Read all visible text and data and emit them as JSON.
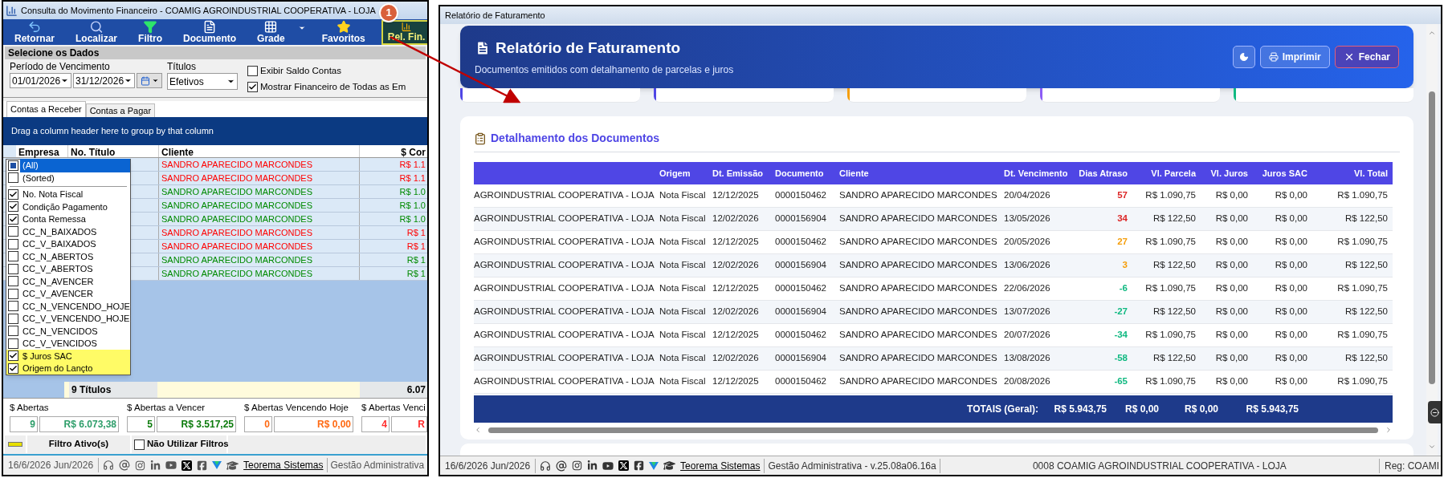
{
  "annotation": {
    "badge": "1"
  },
  "consulta_window": {
    "title": "Consulta do Movimento Financeiro - COAMIG AGROINDUSTRIAL COOPERATIVA - LOJA",
    "toolbar": [
      {
        "label": "Retornar",
        "kind": "return",
        "menu": false,
        "selected": false
      },
      {
        "label": "Localizar",
        "kind": "search",
        "menu": false,
        "selected": false
      },
      {
        "label": "Filtro",
        "kind": "filter",
        "menu": false,
        "selected": false
      },
      {
        "label": "Documento",
        "kind": "document",
        "menu": false,
        "selected": false
      },
      {
        "label": "Grade",
        "kind": "grid",
        "menu": true,
        "selected": false
      },
      {
        "label": "Favoritos",
        "kind": "favorites",
        "menu": false,
        "selected": false
      },
      {
        "label": "Rel. Fin.",
        "kind": "report",
        "menu": false,
        "selected": true
      }
    ],
    "section_title": "Selecione os Dados",
    "period": {
      "label": "Período de Vencimento",
      "from": "01/01/2026",
      "to": "31/12/2026"
    },
    "titulos": {
      "label": "Títulos",
      "value": "Efetivos"
    },
    "options": [
      {
        "label": "Exibir Saldo Contas",
        "checked": false
      },
      {
        "label": "Mostrar Financeiro de Todas as Em",
        "checked": true
      }
    ],
    "tabs": [
      {
        "label": "Contas a Receber",
        "selected": true
      },
      {
        "label": "Contas a Pagar",
        "selected": false
      }
    ],
    "group_hint": "Drag a column header here to group by that column",
    "columns": [
      "Empresa",
      "No. Título",
      "Cliente",
      "$ Cor"
    ],
    "rows": [
      {
        "cliente": "SANDRO APARECIDO MARCONDES",
        "valor": "R$ 1.1",
        "color": "#ff0000"
      },
      {
        "cliente": "SANDRO APARECIDO MARCONDES",
        "valor": "R$ 1.1",
        "color": "#ff0000"
      },
      {
        "cliente": "SANDRO APARECIDO MARCONDES",
        "valor": "R$ 1.0",
        "color": "#008a00"
      },
      {
        "cliente": "SANDRO APARECIDO MARCONDES",
        "valor": "R$ 1.0",
        "color": "#008a00"
      },
      {
        "cliente": "SANDRO APARECIDO MARCONDES",
        "valor": "R$ 1.0",
        "color": "#008a00"
      },
      {
        "cliente": "SANDRO APARECIDO MARCONDES",
        "valor": "R$ 1",
        "color": "#ff0000"
      },
      {
        "cliente": "SANDRO APARECIDO MARCONDES",
        "valor": "R$ 1",
        "color": "#ff0000"
      },
      {
        "cliente": "SANDRO APARECIDO MARCONDES",
        "valor": "R$ 1",
        "color": "#008a00"
      },
      {
        "cliente": "SANDRO APARECIDO MARCONDES",
        "valor": "R$ 1",
        "color": "#008a00"
      }
    ],
    "column_menu": [
      {
        "label": "(All)",
        "checked": false,
        "partial": true,
        "selected": true,
        "highlighted": false
      },
      {
        "label": "(Sorted)",
        "checked": false,
        "partial": false,
        "selected": false,
        "highlighted": false
      },
      {
        "label": "No. Nota Fiscal",
        "checked": true,
        "partial": false,
        "selected": false,
        "highlighted": false
      },
      {
        "label": "Condição Pagamento",
        "checked": true,
        "partial": false,
        "selected": false,
        "highlighted": false
      },
      {
        "label": "Conta Remessa",
        "checked": true,
        "partial": false,
        "selected": false,
        "highlighted": false
      },
      {
        "label": "CC_N_BAIXADOS",
        "checked": false,
        "partial": false,
        "selected": false,
        "highlighted": false
      },
      {
        "label": "CC_V_BAIXADOS",
        "checked": false,
        "partial": false,
        "selected": false,
        "highlighted": false
      },
      {
        "label": "CC_N_ABERTOS",
        "checked": false,
        "partial": false,
        "selected": false,
        "highlighted": false
      },
      {
        "label": "CC_V_ABERTOS",
        "checked": false,
        "partial": false,
        "selected": false,
        "highlighted": false
      },
      {
        "label": "CC_N_AVENCER",
        "checked": false,
        "partial": false,
        "selected": false,
        "highlighted": false
      },
      {
        "label": "CC_V_AVENCER",
        "checked": false,
        "partial": false,
        "selected": false,
        "highlighted": false
      },
      {
        "label": "CC_N_VENCENDO_HOJE",
        "checked": false,
        "partial": false,
        "selected": false,
        "highlighted": false
      },
      {
        "label": "CC_V_VENCENDO_HOJE",
        "checked": false,
        "partial": false,
        "selected": false,
        "highlighted": false
      },
      {
        "label": "CC_N_VENCIDOS",
        "checked": false,
        "partial": false,
        "selected": false,
        "highlighted": false
      },
      {
        "label": "CC_V_VENCIDOS",
        "checked": false,
        "partial": false,
        "selected": false,
        "highlighted": false
      },
      {
        "label": "$ Juros SAC",
        "checked": true,
        "partial": false,
        "selected": false,
        "highlighted": true
      },
      {
        "label": "Origem do Lançto",
        "checked": true,
        "partial": false,
        "selected": false,
        "highlighted": true
      }
    ],
    "summary": {
      "count": "9 Títulos",
      "total": "6.07"
    },
    "totals": [
      {
        "label": "$ Abertas",
        "count": "9",
        "value": "R$ 6.073,38",
        "color": "#2e9e6a"
      },
      {
        "label": "$ Abertas a Vencer",
        "count": "5",
        "value": "R$ 3.517,25",
        "color": "#0a7a0a"
      },
      {
        "label": "$ Abertas Vencendo Hoje",
        "count": "0",
        "value": "R$ 0,00",
        "color": "#ff6a13"
      },
      {
        "label": "$ Abertas Venci",
        "count": "4",
        "value": "R",
        "color": "#ff2a2a"
      }
    ],
    "filter": {
      "label": "Filtro Ativo(s)",
      "no_filter": {
        "label": "Não Utilizar Filtros",
        "checked": false
      }
    },
    "status": {
      "date": "16/6/2026 Jun/2026",
      "link": "Teorema Sistemas",
      "module": "Gestão Administrativa"
    }
  },
  "report_window": {
    "title": "Relatório de Faturamento",
    "header": {
      "title": "Relatório de Faturamento",
      "subtitle": "Documentos emitidos com detalhamento de parcelas e juros",
      "buttons": [
        {
          "label": "Imprimir",
          "kind": "print"
        },
        {
          "label": "Fechar",
          "kind": "close"
        }
      ]
    },
    "stat_cards": [
      {
        "color": "#4f46e5"
      },
      {
        "color": "#4f46e5"
      },
      {
        "color": "#f59e0b"
      },
      {
        "color": "#8b5cf6"
      },
      {
        "color": "#10b981"
      }
    ],
    "detail_title": "Detalhamento dos Documentos",
    "columns": [
      "Origem",
      "Dt. Emissão",
      "Documento",
      "Cliente",
      "Dt. Vencimento",
      "Dias Atraso",
      "Vl. Parcela",
      "Vl. Juros",
      "Juros SAC",
      "Vl. Total"
    ],
    "rows": [
      {
        "empresa": "AGROINDUSTRIAL COOPERATIVA - LOJA",
        "origem": "Nota Fiscal",
        "emissao": "12/12/2025",
        "documento": "0000150462",
        "cliente": "SANDRO APARECIDO MARCONDES",
        "vencimento": "20/04/2026",
        "atraso": "57",
        "color": "#dc2626",
        "parcela": "R$ 1.090,75",
        "juros": "R$ 0,00",
        "juros_sac": "R$ 0,00",
        "total": "R$ 1.090,75"
      },
      {
        "empresa": "AGROINDUSTRIAL COOPERATIVA - LOJA",
        "origem": "Nota Fiscal",
        "emissao": "12/02/2026",
        "documento": "0000156904",
        "cliente": "SANDRO APARECIDO MARCONDES",
        "vencimento": "13/05/2026",
        "atraso": "34",
        "color": "#dc2626",
        "parcela": "R$ 122,50",
        "juros": "R$ 0,00",
        "juros_sac": "R$ 0,00",
        "total": "R$ 122,50"
      },
      {
        "empresa": "AGROINDUSTRIAL COOPERATIVA - LOJA",
        "origem": "Nota Fiscal",
        "emissao": "12/12/2025",
        "documento": "0000150462",
        "cliente": "SANDRO APARECIDO MARCONDES",
        "vencimento": "20/05/2026",
        "atraso": "27",
        "color": "#f59e0b",
        "parcela": "R$ 1.090,75",
        "juros": "R$ 0,00",
        "juros_sac": "R$ 0,00",
        "total": "R$ 1.090,75"
      },
      {
        "empresa": "AGROINDUSTRIAL COOPERATIVA - LOJA",
        "origem": "Nota Fiscal",
        "emissao": "12/02/2026",
        "documento": "0000156904",
        "cliente": "SANDRO APARECIDO MARCONDES",
        "vencimento": "13/06/2026",
        "atraso": "3",
        "color": "#f59e0b",
        "parcela": "R$ 122,50",
        "juros": "R$ 0,00",
        "juros_sac": "R$ 0,00",
        "total": "R$ 122,50"
      },
      {
        "empresa": "AGROINDUSTRIAL COOPERATIVA - LOJA",
        "origem": "Nota Fiscal",
        "emissao": "12/12/2025",
        "documento": "0000150462",
        "cliente": "SANDRO APARECIDO MARCONDES",
        "vencimento": "22/06/2026",
        "atraso": "-6",
        "color": "#10b981",
        "parcela": "R$ 1.090,75",
        "juros": "R$ 0,00",
        "juros_sac": "R$ 0,00",
        "total": "R$ 1.090,75"
      },
      {
        "empresa": "AGROINDUSTRIAL COOPERATIVA - LOJA",
        "origem": "Nota Fiscal",
        "emissao": "12/02/2026",
        "documento": "0000156904",
        "cliente": "SANDRO APARECIDO MARCONDES",
        "vencimento": "13/07/2026",
        "atraso": "-27",
        "color": "#10b981",
        "parcela": "R$ 122,50",
        "juros": "R$ 0,00",
        "juros_sac": "R$ 0,00",
        "total": "R$ 122,50"
      },
      {
        "empresa": "AGROINDUSTRIAL COOPERATIVA - LOJA",
        "origem": "Nota Fiscal",
        "emissao": "12/12/2025",
        "documento": "0000150462",
        "cliente": "SANDRO APARECIDO MARCONDES",
        "vencimento": "20/07/2026",
        "atraso": "-34",
        "color": "#10b981",
        "parcela": "R$ 1.090,75",
        "juros": "R$ 0,00",
        "juros_sac": "R$ 0,00",
        "total": "R$ 1.090,75"
      },
      {
        "empresa": "AGROINDUSTRIAL COOPERATIVA - LOJA",
        "origem": "Nota Fiscal",
        "emissao": "12/02/2026",
        "documento": "0000156904",
        "cliente": "SANDRO APARECIDO MARCONDES",
        "vencimento": "13/08/2026",
        "atraso": "-58",
        "color": "#10b981",
        "parcela": "R$ 122,50",
        "juros": "R$ 0,00",
        "juros_sac": "R$ 0,00",
        "total": "R$ 122,50"
      },
      {
        "empresa": "AGROINDUSTRIAL COOPERATIVA - LOJA",
        "origem": "Nota Fiscal",
        "emissao": "12/12/2025",
        "documento": "0000150462",
        "cliente": "SANDRO APARECIDO MARCONDES",
        "vencimento": "20/08/2026",
        "atraso": "-65",
        "color": "#10b981",
        "parcela": "R$ 1.090,75",
        "juros": "R$ 0,00",
        "juros_sac": "R$ 0,00",
        "total": "R$ 1.090,75"
      }
    ],
    "totals": {
      "label": "TOTAIS (Geral):",
      "parcela": "R$ 5.943,75",
      "juros": "R$ 0,00",
      "juros_sac": "R$ 0,00",
      "total": "R$ 5.943,75"
    },
    "status": {
      "date": "16/6/2026 Jun/2026",
      "link": "Teorema Sistemas",
      "version": "Gestão Administrativa - v.25.08a06.16a",
      "company": "0008 COAMIG AGROINDUSTRIAL COOPERATIVA - LOJA",
      "reg": "Reg: COAMI"
    }
  }
}
